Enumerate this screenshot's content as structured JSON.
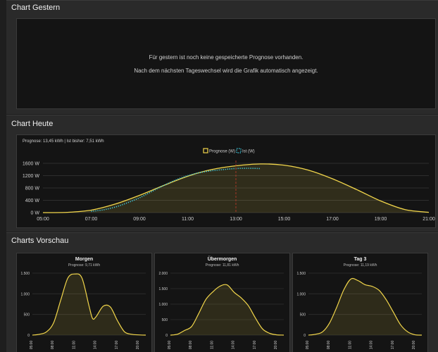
{
  "sections": {
    "gestern": {
      "title": "Chart Gestern",
      "message_line1": "Für gestern ist noch keine gespeicherte Prognose vorhanden.",
      "message_line2": "Nach dem nächsten Tageswechsel wird die Grafik automatisch angezeigt."
    },
    "heute": {
      "title": "Chart Heute",
      "subtitle": "Prognose: 13,45 kWh | Ist bisher: 7,51 kWh"
    },
    "vorschau": {
      "title": "Charts Vorschau"
    }
  },
  "colors": {
    "forecast": "#f2d64b",
    "actual": "#3fd0e6",
    "now_line": "#c0392b",
    "grid": "#2e2e2e",
    "axis_text": "#cfcfcf"
  },
  "chart_data": [
    {
      "type": "line",
      "id": "heute",
      "legend": [
        "Prognose (W)",
        "Ist (W)"
      ],
      "x_ticks": [
        "05:00",
        "07:00",
        "09:00",
        "11:00",
        "13:00",
        "15:00",
        "17:00",
        "19:00",
        "21:00"
      ],
      "y_ticks": [
        "0 W",
        "400 W",
        "800 W",
        "1200 W",
        "1600 W"
      ],
      "xlim": [
        5,
        21
      ],
      "ylim": [
        0,
        1600
      ],
      "now_marker": 13.0,
      "series": [
        {
          "name": "Prognose (W)",
          "x": [
            5,
            6,
            7,
            8,
            9,
            10,
            11,
            12,
            13,
            14,
            15,
            16,
            17,
            18,
            19,
            20,
            21
          ],
          "values": [
            0,
            10,
            80,
            280,
            560,
            880,
            1180,
            1400,
            1520,
            1580,
            1540,
            1380,
            1100,
            750,
            380,
            100,
            10
          ]
        },
        {
          "name": "Ist (W)",
          "x": [
            7,
            7.5,
            8,
            8.5,
            9,
            9.5,
            10,
            10.5,
            11,
            11.5,
            12,
            12.5,
            13,
            13.5,
            14
          ],
          "values": [
            40,
            90,
            180,
            320,
            480,
            680,
            880,
            1060,
            1200,
            1300,
            1360,
            1400,
            1430,
            1440,
            1430
          ]
        }
      ]
    },
    {
      "type": "area",
      "id": "morgen",
      "title": "Morgen",
      "subtitle": "Prognose: 9,71 kWh",
      "x_ticks": [
        "05:00",
        "08:00",
        "11:00",
        "14:00",
        "17:00",
        "20:00"
      ],
      "y_ticks": [
        "0",
        "500",
        "1.000",
        "1.500"
      ],
      "xlim": [
        5,
        21
      ],
      "ylim": [
        0,
        1500
      ],
      "x": [
        5,
        6,
        7,
        8,
        9,
        10,
        11,
        12,
        13,
        13.5,
        14,
        15,
        16,
        17,
        18,
        19,
        20,
        21
      ],
      "values": [
        0,
        20,
        80,
        300,
        850,
        1380,
        1480,
        1380,
        700,
        400,
        450,
        700,
        680,
        350,
        80,
        20,
        5,
        0
      ]
    },
    {
      "type": "area",
      "id": "uebermorgen",
      "title": "Übermorgen",
      "subtitle": "Prognose: 11,81 kWh",
      "x_ticks": [
        "05:00",
        "08:00",
        "11:00",
        "14:00",
        "17:00",
        "20:00"
      ],
      "y_ticks": [
        "0",
        "500",
        "1.000",
        "1.500",
        "2.000"
      ],
      "xlim": [
        5,
        21
      ],
      "ylim": [
        0,
        2000
      ],
      "x": [
        5,
        6,
        7,
        8,
        9,
        10,
        11,
        12,
        13,
        14,
        15,
        16,
        17,
        18,
        19,
        20,
        21
      ],
      "values": [
        0,
        30,
        150,
        280,
        700,
        1150,
        1400,
        1580,
        1620,
        1380,
        1200,
        950,
        550,
        200,
        60,
        10,
        0
      ]
    },
    {
      "type": "area",
      "id": "tag3",
      "title": "Tag 3",
      "subtitle": "Prognose: 11,19 kWh",
      "x_ticks": [
        "05:00",
        "08:00",
        "11:00",
        "14:00",
        "17:00",
        "20:00"
      ],
      "y_ticks": [
        "0",
        "500",
        "1.000",
        "1.500"
      ],
      "xlim": [
        5,
        21
      ],
      "ylim": [
        0,
        1500
      ],
      "x": [
        5,
        6,
        7,
        8,
        9,
        10,
        11,
        12,
        13,
        14,
        15,
        16,
        17,
        18,
        19,
        20,
        21
      ],
      "values": [
        0,
        20,
        80,
        300,
        680,
        1100,
        1360,
        1320,
        1220,
        1180,
        1080,
        850,
        550,
        250,
        80,
        10,
        0
      ]
    }
  ]
}
